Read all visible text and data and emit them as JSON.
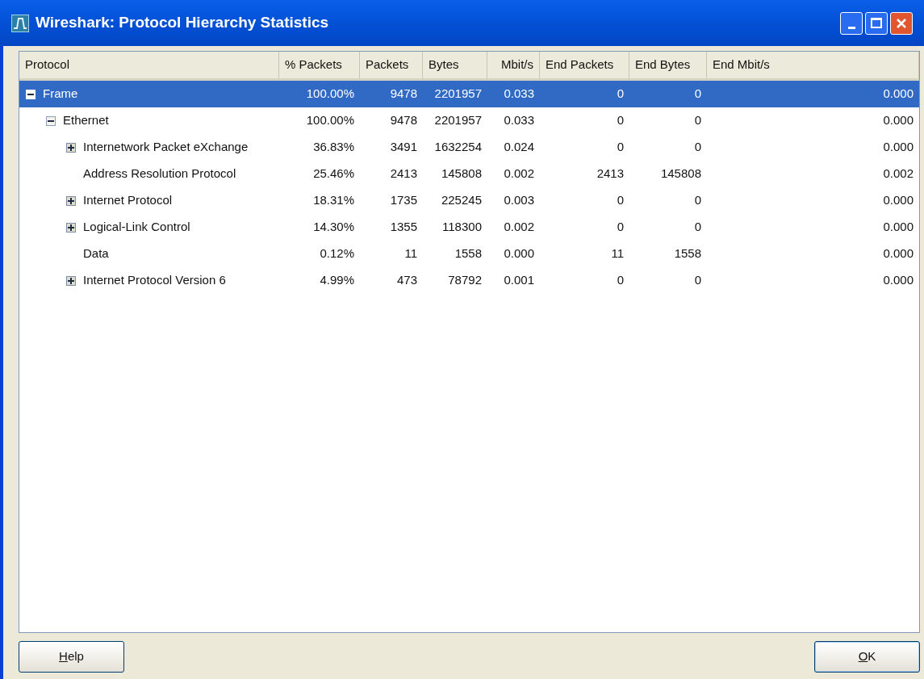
{
  "window": {
    "title": "Wireshark: Protocol Hierarchy Statistics"
  },
  "table": {
    "columns": [
      "Protocol",
      "% Packets",
      "Packets",
      "Bytes",
      "Mbit/s",
      "End Packets",
      "End Bytes",
      "End Mbit/s"
    ],
    "rows": [
      {
        "protocol": "Frame",
        "kind": "branch",
        "expanded": true,
        "selected": true,
        "values": [
          "100.00%",
          "9478",
          "2201957",
          "0.033",
          "0",
          "0",
          "0.000"
        ],
        "children": [
          {
            "protocol": "Ethernet",
            "kind": "branch",
            "expanded": true,
            "selected": false,
            "values": [
              "100.00%",
              "9478",
              "2201957",
              "0.033",
              "0",
              "0",
              "0.000"
            ],
            "children": [
              {
                "protocol": "Internetwork Packet eXchange",
                "kind": "branch",
                "expanded": false,
                "selected": false,
                "values": [
                  "36.83%",
                  "3491",
                  "1632254",
                  "0.024",
                  "0",
                  "0",
                  "0.000"
                ]
              },
              {
                "protocol": "Address Resolution Protocol",
                "kind": "leaf",
                "selected": false,
                "values": [
                  "25.46%",
                  "2413",
                  "145808",
                  "0.002",
                  "2413",
                  "145808",
                  "0.002"
                ]
              },
              {
                "protocol": "Internet Protocol",
                "kind": "branch",
                "expanded": false,
                "selected": false,
                "values": [
                  "18.31%",
                  "1735",
                  "225245",
                  "0.003",
                  "0",
                  "0",
                  "0.000"
                ]
              },
              {
                "protocol": "Logical-Link Control",
                "kind": "branch",
                "expanded": false,
                "selected": false,
                "values": [
                  "14.30%",
                  "1355",
                  "118300",
                  "0.002",
                  "0",
                  "0",
                  "0.000"
                ]
              },
              {
                "protocol": "Data",
                "kind": "leaf",
                "selected": false,
                "values": [
                  "0.12%",
                  "11",
                  "1558",
                  "0.000",
                  "11",
                  "1558",
                  "0.000"
                ]
              },
              {
                "protocol": "Internet Protocol Version 6",
                "kind": "branch",
                "expanded": false,
                "selected": false,
                "values": [
                  "4.99%",
                  "473",
                  "78792",
                  "0.001",
                  "0",
                  "0",
                  "0.000"
                ]
              }
            ]
          }
        ]
      }
    ]
  },
  "buttons": [
    {
      "label": "Help"
    },
    {
      "label": "OK"
    }
  ]
}
